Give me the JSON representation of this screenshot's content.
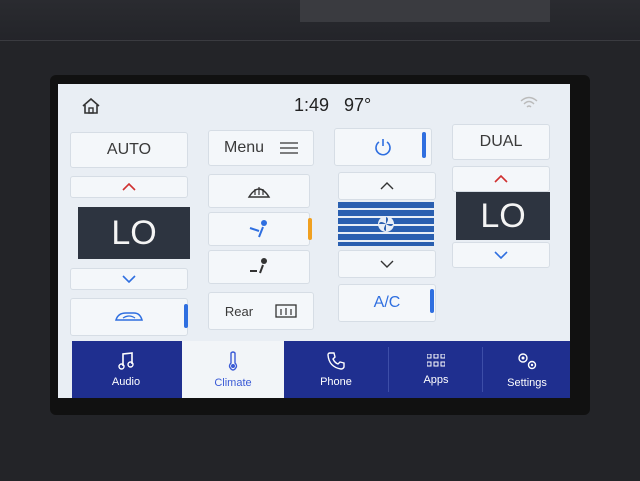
{
  "status": {
    "time": "1:49",
    "temperature": "97°"
  },
  "climate": {
    "auto_label": "AUTO",
    "menu_label": "Menu",
    "dual_label": "DUAL",
    "left_temp": "LO",
    "right_temp": "LO",
    "rear_label": "Rear",
    "ac_label": "A/C"
  },
  "nav": {
    "items": [
      {
        "label": "Audio"
      },
      {
        "label": "Climate"
      },
      {
        "label": "Phone"
      },
      {
        "label": "Apps"
      },
      {
        "label": "Settings"
      }
    ],
    "active": "Climate"
  },
  "colors": {
    "accent_blue": "#2f6fe0",
    "indicator_orange": "#f0a020",
    "nav_bg": "#1f2f8f",
    "arrow_red": "#d03030"
  }
}
